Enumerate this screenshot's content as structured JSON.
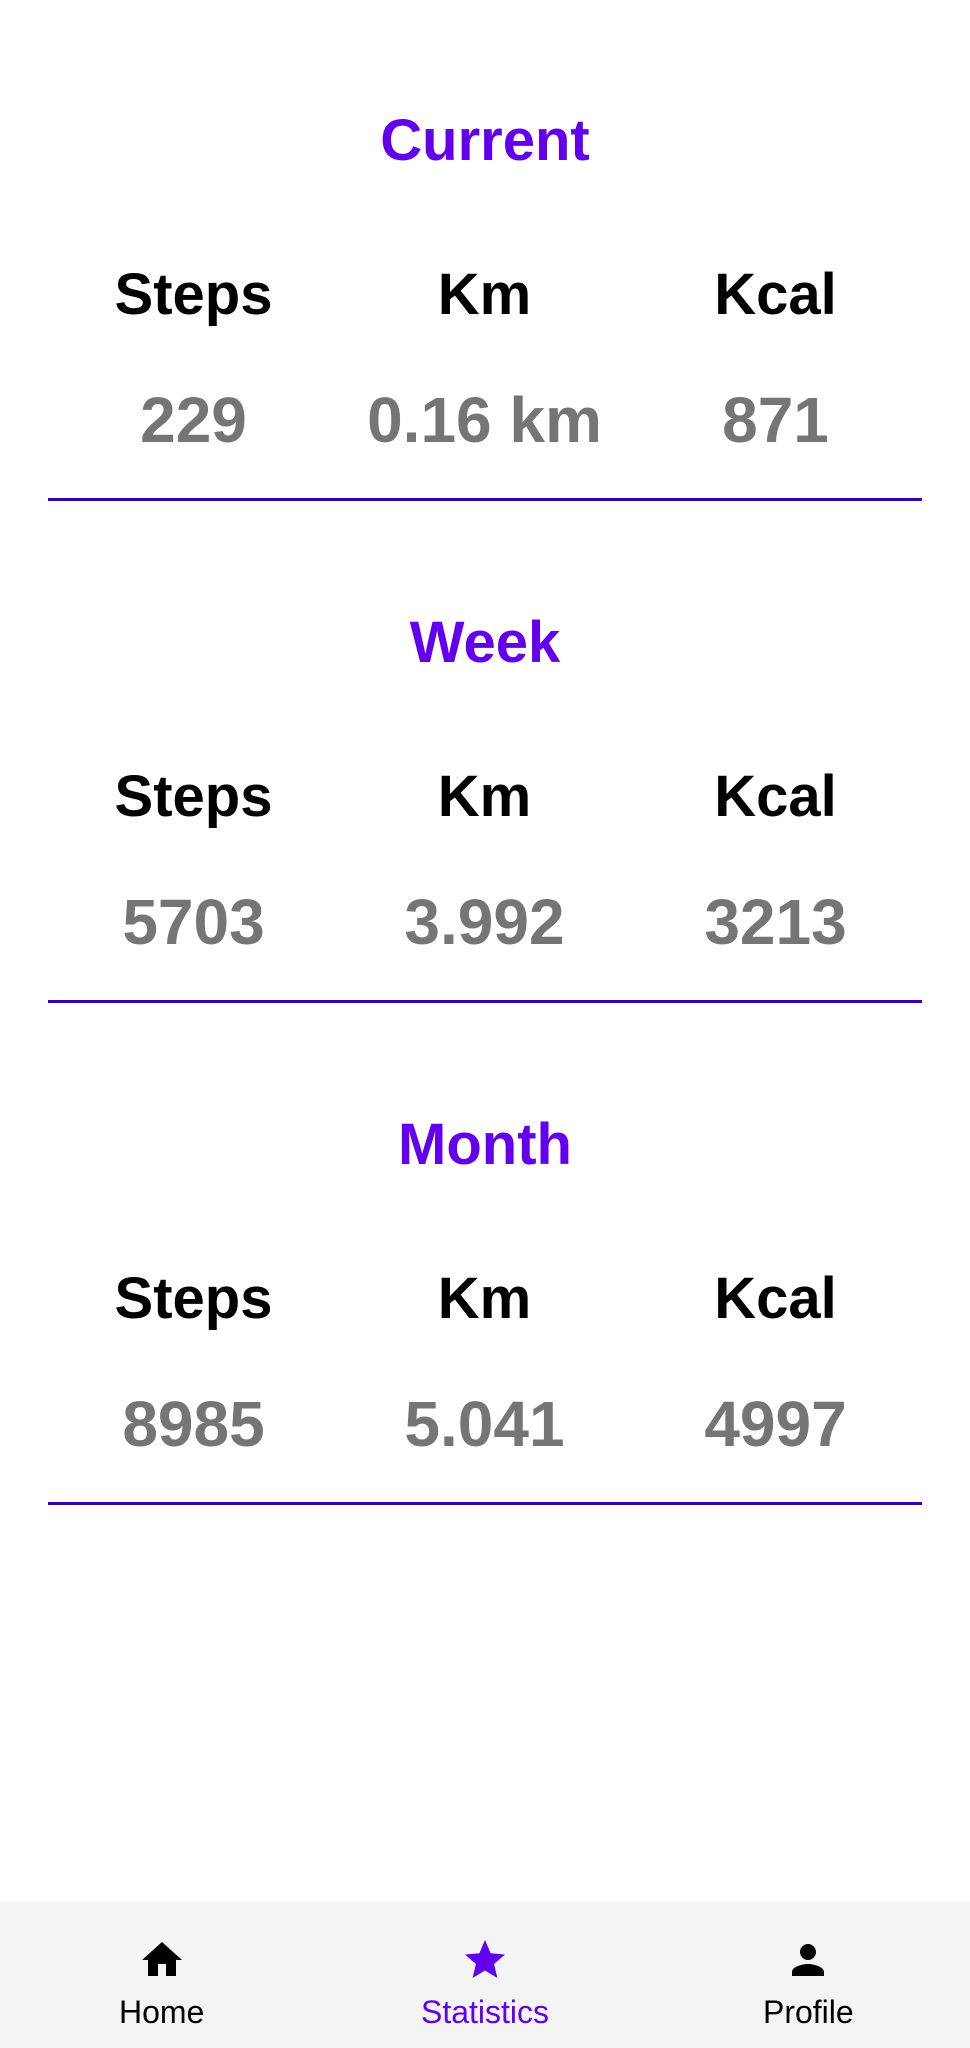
{
  "sections": [
    {
      "title": "Current",
      "stats": [
        {
          "label": "Steps",
          "value": "229"
        },
        {
          "label": "Km",
          "value": "0.16 km"
        },
        {
          "label": "Kcal",
          "value": "871"
        }
      ]
    },
    {
      "title": "Week",
      "stats": [
        {
          "label": "Steps",
          "value": "5703"
        },
        {
          "label": "Km",
          "value": "3.992"
        },
        {
          "label": "Kcal",
          "value": "3213"
        }
      ]
    },
    {
      "title": "Month",
      "stats": [
        {
          "label": "Steps",
          "value": "8985"
        },
        {
          "label": "Km",
          "value": "5.041"
        },
        {
          "label": "Kcal",
          "value": "4997"
        }
      ]
    }
  ],
  "bottom_nav": {
    "items": [
      {
        "label": "Home",
        "icon": "home-icon",
        "active": false
      },
      {
        "label": "Statistics",
        "icon": "star-icon",
        "active": true
      },
      {
        "label": "Profile",
        "icon": "person-icon",
        "active": false
      }
    ]
  },
  "colors": {
    "accent": "#6200ee",
    "divider": "#3700b3",
    "value_text": "#757575",
    "label_text": "#000000",
    "nav_background": "#f4f4f4"
  }
}
